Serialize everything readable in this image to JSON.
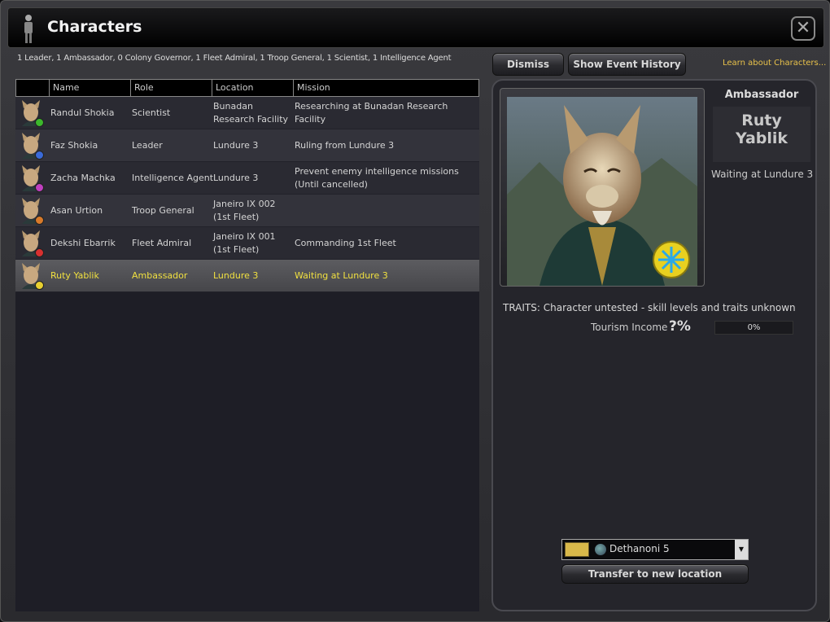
{
  "window": {
    "title": "Characters",
    "close_icon": "close-icon"
  },
  "summary": "1 Leader, 1 Ambassador, 0 Colony Governor, 1 Fleet Admiral, 1 Troop General, 1 Scientist, 1 Intelligence Agent",
  "toolbar": {
    "dismiss_label": "Dismiss",
    "history_label": "Show Event History",
    "learn_label": "Learn about Characters..."
  },
  "table": {
    "headers": [
      "Name",
      "Role",
      "Location",
      "Mission"
    ],
    "rows": [
      {
        "name": "Randul Shokia",
        "role": "Scientist",
        "location": "Bunadan Research Facility",
        "mission": "Researching at Bunadan Research Facility",
        "badge": "#3cb82c"
      },
      {
        "name": "Faz Shokia",
        "role": "Leader",
        "location": "Lundure 3",
        "mission": "Ruling from Lundure 3",
        "badge": "#3a6ad8"
      },
      {
        "name": "Zacha Machka",
        "role": "Intelligence Agent",
        "location": "Lundure 3",
        "mission": "Prevent enemy intelligence missions (Until cancelled)",
        "badge": "#c040c0"
      },
      {
        "name": "Asan Urtion",
        "role": "Troop General",
        "location": "Janeiro IX 002 (1st Fleet)",
        "mission": "",
        "badge": "#d87a2a"
      },
      {
        "name": "Dekshi Ebarrik",
        "role": "Fleet Admiral",
        "location": "Janeiro IX 001 (1st Fleet)",
        "mission": "Commanding 1st Fleet",
        "badge": "#d83030"
      },
      {
        "name": "Ruty Yablik",
        "role": "Ambassador",
        "location": "Lundure 3",
        "mission": "Waiting at Lundure 3",
        "badge": "#e8d030"
      }
    ]
  },
  "detail": {
    "role": "Ambassador",
    "name": "Ruty Yablik",
    "status": "Waiting at Lundure 3",
    "traits": "TRAITS: Character untested - skill levels and traits unknown",
    "tourism_label": "Tourism Income",
    "tourism_value": "?%",
    "tourism_bar_text": "0%",
    "tourism_bar_fraction": 0,
    "location_select": "Dethanoni 5",
    "transfer_label": "Transfer to new location"
  },
  "colors": {
    "accent_yellow": "#f0e040",
    "link": "#e8c14a"
  }
}
